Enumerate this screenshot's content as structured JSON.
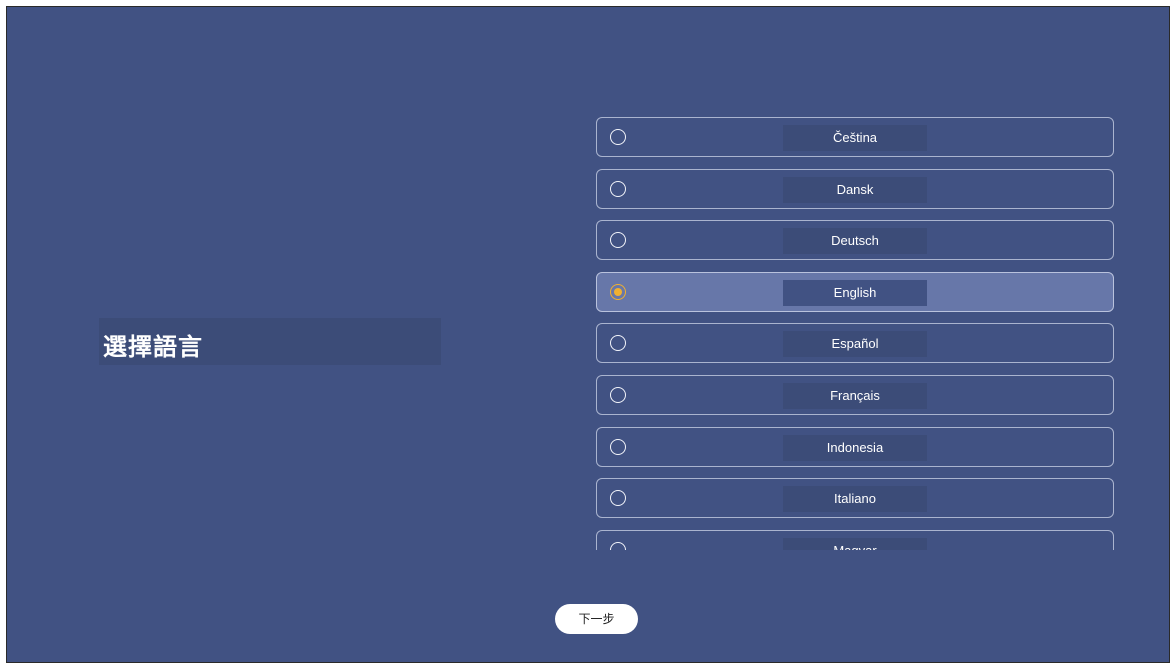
{
  "page": {
    "title": "選擇語言",
    "next_label": "下一步"
  },
  "languages": [
    {
      "label": "Čeština",
      "selected": false
    },
    {
      "label": "Dansk",
      "selected": false
    },
    {
      "label": "Deutsch",
      "selected": false
    },
    {
      "label": "English",
      "selected": true
    },
    {
      "label": "Español",
      "selected": false
    },
    {
      "label": "Français",
      "selected": false
    },
    {
      "label": "Indonesia",
      "selected": false
    },
    {
      "label": "Italiano",
      "selected": false
    },
    {
      "label": "Magyar",
      "selected": false
    }
  ],
  "colors": {
    "background": "#415283",
    "selected_row": "#6777a9",
    "radio_accent": "#f0b030"
  }
}
